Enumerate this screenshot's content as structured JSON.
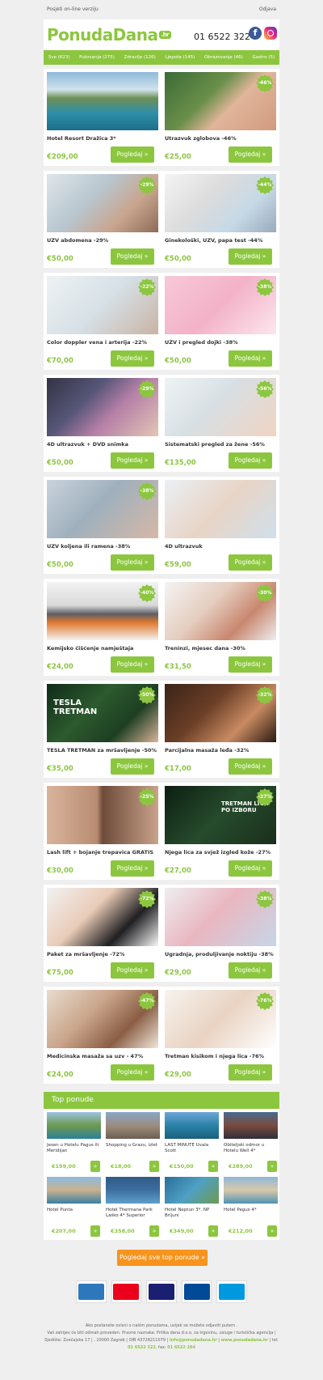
{
  "topbar": {
    "online": "Posjeti on-line verziju",
    "logout": "Odjava"
  },
  "header": {
    "logo_text": "PonudaDana",
    "logo_suffix": ".hr",
    "phone": "01 6522 322",
    "fb_icon": "f"
  },
  "nav": [
    "Sve (623)",
    "Putovanja (275)",
    "Zdravlje (126)",
    "Ljepota (145)",
    "Obrazovanje (46)",
    "Gastro (5)"
  ],
  "button_label": "Pogledaj »",
  "offers": [
    [
      {
        "title": "Hotel Resort Dražica 3*",
        "price": "€209,00",
        "badge": "",
        "img": "coast"
      },
      {
        "title": "Utrazvuk zglobova -46%",
        "price": "€25,00",
        "badge": "-46%",
        "img": "knee"
      }
    ],
    [
      {
        "title": "UZV abdomena -29%",
        "price": "€50,00",
        "badge": "-29%",
        "img": "ultra"
      },
      {
        "title": "Ginekološki, UZV, papa test -44%",
        "price": "€50,00",
        "badge": "-44%",
        "img": "doctor"
      }
    ],
    [
      {
        "title": "Color doppler vena i arterija -22%",
        "price": "€70,00",
        "badge": "-22%",
        "img": "doctor2"
      },
      {
        "title": "UZV i pregled dojki -38%",
        "price": "€50,00",
        "badge": "-38%",
        "img": "pink"
      }
    ],
    [
      {
        "title": "4D ultrazvuk + DVD snimka",
        "price": "€50,00",
        "badge": "-29%",
        "img": "preg"
      },
      {
        "title": "Sistematski pregled za žene -56%",
        "price": "€135,00",
        "badge": "-56%",
        "img": "doctor3"
      }
    ],
    [
      {
        "title": "UZV koljena ili ramena -38%",
        "price": "€50,00",
        "badge": "-38%",
        "img": "ultra2"
      },
      {
        "title": "4D ultrazvuk",
        "price": "€59,00",
        "badge": "",
        "img": "preg2"
      }
    ],
    [
      {
        "title": "Kemijsko čišćenje namještaja",
        "price": "€24,00",
        "badge": "-40%",
        "img": "sofa"
      },
      {
        "title": "Treninzi, mjesec dana -30%",
        "price": "€31,50",
        "badge": "-30%",
        "img": "fit"
      }
    ],
    [
      {
        "title": "TESLA TRETMAN za mršavljenje -50%",
        "price": "€35,00",
        "badge": "-50%",
        "img": "tesla",
        "overlay": "TESLA\nTRETMAN"
      },
      {
        "title": "Parcijalna masaža leđa -32%",
        "price": "€17,00",
        "badge": "-32%",
        "img": "massage"
      }
    ],
    [
      {
        "title": "Lash lift + bojanje trepavica GRATIS",
        "price": "€30,00",
        "badge": "-25%",
        "img": "eye"
      },
      {
        "title": "Njega lica za svjež izgled kože -27%",
        "price": "€27,00",
        "badge": "-27%",
        "img": "face",
        "overlay": "TRETMAN LICA\nPO IZBORU"
      }
    ],
    [
      {
        "title": "Paket za mršavljenje -72%",
        "price": "€75,00",
        "badge": "-72%",
        "img": "waist"
      },
      {
        "title": "Ugradnja, produljivanje noktiju -38%",
        "price": "€29,00",
        "badge": "-38%",
        "img": "nails"
      }
    ],
    [
      {
        "title": "Medicinska masaža sa uzv - 47%",
        "price": "€24,00",
        "badge": "-47%",
        "img": "massage2"
      },
      {
        "title": "Tretman kisikom i njega lica -76%",
        "price": "€29,00",
        "badge": "-76%",
        "img": "spa"
      }
    ]
  ],
  "top": {
    "heading": "Top ponude",
    "button": "»",
    "items": [
      {
        "name": "Jesen u Hotelu Pagus ili Meridijan",
        "price": "€199,00"
      },
      {
        "name": "Shopping u Grazu, izlet",
        "price": "€18,00"
      },
      {
        "name": "LAST MINUTE Uvala Scott",
        "price": "€150,00"
      },
      {
        "name": "Obiteljski odmor u Hotelu Well 4*",
        "price": "€289,00"
      },
      {
        "name": "Hotel Punta",
        "price": "€207,00"
      },
      {
        "name": "Hotel Thermana Park Laško 4* Superior",
        "price": "€358,00"
      },
      {
        "name": "Hotel Neptun 3*, NP Brijuni",
        "price": "€349,00"
      },
      {
        "name": "Hotel Pagus 4*",
        "price": "€212,00"
      }
    ]
  },
  "all_offers_button": "Pogledaj sve top ponude »",
  "payment_cards": [
    {
      "label": "AMEX",
      "color": "#2e77bb"
    },
    {
      "label": "MasterCard",
      "color": "#eb001b"
    },
    {
      "label": "VISA",
      "color": "#1a1f71"
    },
    {
      "label": "Diners",
      "color": "#004a97"
    },
    {
      "label": "Maestro",
      "color": "#0099df"
    }
  ],
  "footer": {
    "line1": "Ako postanete ovisni o našim ponudama, uvijek se možete odjaviti putem .",
    "line2": "Vaš zahtjev će biti odmah proveden. Pravne naznake. Prilika dana d.o.o. za trgovinu, usluge i turistička agencija |",
    "line3a": "Sjedište: Zvečajska 17 | , 10000 Zagreb | OIB 43728211079 |",
    "email": "info@ponudadana.hr",
    "sep1": "|",
    "site": "www.ponudadana.hr",
    "line3b": "| tel:",
    "tel": "01 6522 322",
    "fax_label": ", fax:",
    "fax": "01 6522 264"
  }
}
